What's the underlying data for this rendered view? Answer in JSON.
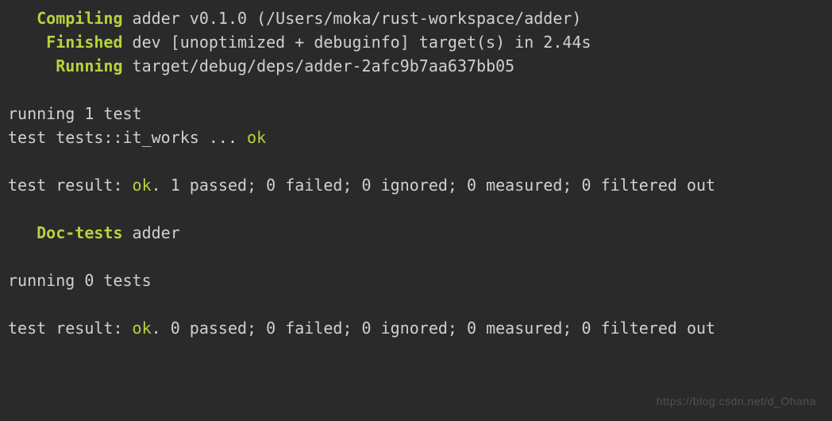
{
  "lines": {
    "l1_label": "Compiling",
    "l1_text": " adder v0.1.0 (/Users/moka/rust-workspace/adder)",
    "l2_label": "Finished",
    "l2_text": " dev [unoptimized + debuginfo] target(s) in 2.44s",
    "l3_label": "Running",
    "l3_text": " target/debug/deps/adder-2afc9b7aa637bb05",
    "l4_text": "running 1 test",
    "l5_prefix": "test tests::it_works ... ",
    "l5_ok": "ok",
    "l6_prefix": "test result: ",
    "l6_ok": "ok",
    "l6_suffix": ". 1 passed; 0 failed; 0 ignored; 0 measured; 0 filtered out",
    "l7_label": "Doc-tests",
    "l7_text": " adder",
    "l8_text": "running 0 tests",
    "l9_prefix": "test result: ",
    "l9_ok": "ok",
    "l9_suffix": ". 0 passed; 0 failed; 0 ignored; 0 measured; 0 filtered out"
  },
  "watermark": "https://blog.csdn.net/d_Ohana"
}
